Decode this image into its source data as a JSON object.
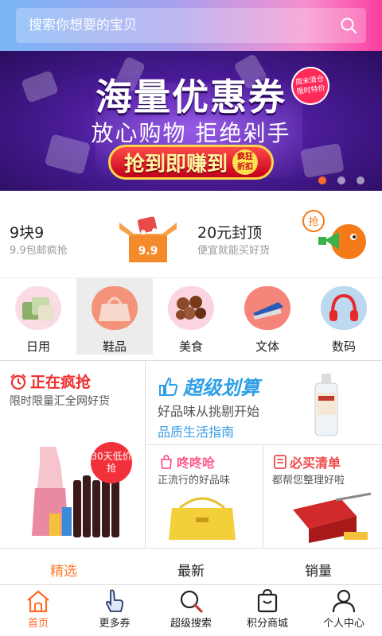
{
  "search": {
    "placeholder": "搜索你想要的宝贝"
  },
  "banner": {
    "title": "海量优惠券",
    "subtitle": "放心购物 拒绝剁手",
    "button_text": "抢到即赚到",
    "button_tag": "疯狂折扣",
    "badge": "周末清仓限时特价",
    "slide_count": 3,
    "active_slide": 1
  },
  "promo": {
    "left_title": "9块9",
    "left_sub": "9.9包邮疯抢",
    "box_label": "9.9",
    "right_title": "20元封顶",
    "right_sub": "便宜就能买好货",
    "mascot_text": "抢"
  },
  "categories": [
    {
      "label": "日用",
      "icon": "pillow-icon"
    },
    {
      "label": "鞋品",
      "icon": "handbag-icon"
    },
    {
      "label": "美食",
      "icon": "chocolate-icon"
    },
    {
      "label": "文体",
      "icon": "stapler-icon"
    },
    {
      "label": "数码",
      "icon": "headphones-icon"
    }
  ],
  "grid": {
    "hot_title": "正在疯抢",
    "hot_sub": "限时限量汇全网好货",
    "hot_badge": "30天低价抢",
    "super_title": "超级划算",
    "super_sub": "好品味从挑剔开始",
    "super_link": "品质生活指南",
    "dongdong_title": "咚咚呛",
    "dongdong_sub": "正流行的好品味",
    "must_buy_title": "必买清单",
    "must_buy_sub": "都帮您整理好啦"
  },
  "tabs": [
    {
      "label": "精选"
    },
    {
      "label": "最新"
    },
    {
      "label": "销量"
    }
  ],
  "nav": [
    {
      "label": "首页",
      "icon": "home-icon"
    },
    {
      "label": "更多券",
      "icon": "hand-pointer-icon"
    },
    {
      "label": "超级搜索",
      "icon": "search-icon"
    },
    {
      "label": "积分商城",
      "icon": "shopping-bag-icon"
    },
    {
      "label": "个人中心",
      "icon": "user-icon"
    }
  ],
  "colors": {
    "accent": "#ff6a2a",
    "hot_red": "#f02c2c",
    "super_blue": "#2c9fe8",
    "dongdong_pink": "#ff5a8a",
    "must_buy_red": "#f04848"
  }
}
